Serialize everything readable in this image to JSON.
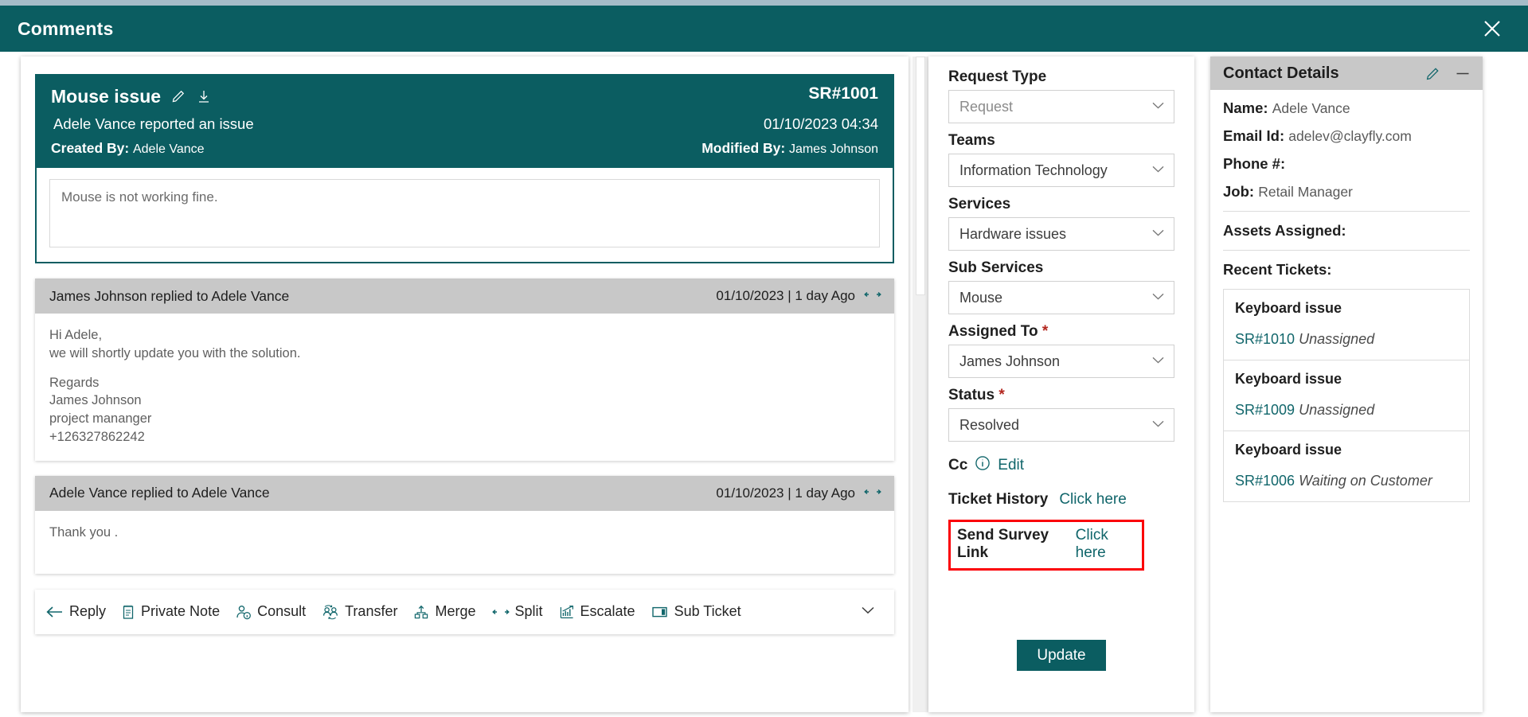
{
  "theme": {
    "teal": "#0b5d61",
    "link_teal": "#11666b",
    "grey_head": "#c8c8c8",
    "red_highlight": "#fb0007"
  },
  "window": {
    "title": "Comments",
    "close_icon": "close-icon"
  },
  "ticket": {
    "subject": "Mouse issue",
    "edit_icon": "pencil-icon",
    "download_icon": "download-icon",
    "id": "SR#1001",
    "reported_line": "Adele Vance reported an issue",
    "created_at": "01/10/2023 04:34",
    "created_by_label": "Created By:",
    "created_by": "Adele Vance",
    "modified_by_label": "Modified By:",
    "modified_by": "James Johnson",
    "description": "Mouse is not working fine."
  },
  "replies": [
    {
      "header": "James Johnson replied to Adele Vance",
      "timestamp": "01/10/2023 | 1 day Ago",
      "expand_icon": "expand-horizontal-icon",
      "lines": [
        "Hi Adele,",
        "we will shortly update you with the solution.",
        "",
        "Regards",
        "James Johnson",
        "project mananger",
        "+126327862242"
      ]
    },
    {
      "header": "Adele Vance replied to Adele Vance",
      "timestamp": "01/10/2023 | 1 day Ago",
      "expand_icon": "expand-horizontal-icon",
      "lines": [
        "Thank you ."
      ]
    }
  ],
  "toolbar": {
    "items": [
      {
        "label": "Reply",
        "icon": "reply-arrow-icon"
      },
      {
        "label": "Private Note",
        "icon": "note-icon"
      },
      {
        "label": "Consult",
        "icon": "person-info-icon"
      },
      {
        "label": "Transfer",
        "icon": "transfer-people-icon"
      },
      {
        "label": "Merge",
        "icon": "merge-icon"
      },
      {
        "label": "Split",
        "icon": "split-arrows-icon"
      },
      {
        "label": "Escalate",
        "icon": "escalate-chart-icon"
      },
      {
        "label": "Sub Ticket",
        "icon": "sub-ticket-columns-icon"
      }
    ],
    "more_icon": "chevron-down-icon"
  },
  "form": {
    "fields": [
      {
        "label": "Request Type",
        "value": "Request",
        "required": false,
        "placeholder_style": true,
        "caret": "chevron-down-icon"
      },
      {
        "label": "Teams",
        "value": "Information Technology",
        "required": false,
        "placeholder_style": false,
        "caret": "chevron-down-icon"
      },
      {
        "label": "Services",
        "value": "Hardware issues",
        "required": false,
        "placeholder_style": false,
        "caret": "chevron-down-icon"
      },
      {
        "label": "Sub Services",
        "value": "Mouse",
        "required": false,
        "placeholder_style": false,
        "caret": "chevron-down-icon"
      },
      {
        "label": "Assigned To",
        "value": "James Johnson",
        "required": true,
        "placeholder_style": false,
        "caret": "chevron-down-icon"
      },
      {
        "label": "Status",
        "value": "Resolved",
        "required": true,
        "placeholder_style": false,
        "caret": "chevron-down-icon"
      }
    ],
    "cc": {
      "label": "Cc",
      "info_icon": "info-circle-icon",
      "link": "Edit"
    },
    "ticket_history": {
      "label": "Ticket History",
      "link": "Click here"
    },
    "send_survey": {
      "label": "Send Survey Link",
      "link": "Click here",
      "highlighted": true
    },
    "update_label": "Update"
  },
  "contact": {
    "panel_title": "Contact Details",
    "edit_icon": "pencil-icon",
    "minimize_icon": "minimize-icon",
    "name_label": "Name:",
    "name": "Adele Vance",
    "email_label": "Email Id:",
    "email": "adelev@clayfly.com",
    "phone_label": "Phone #:",
    "phone": "",
    "job_label": "Job:",
    "job": "Retail Manager",
    "assets_label": "Assets Assigned:",
    "recent_label": "Recent Tickets:",
    "recent_tickets": [
      {
        "title": "Keyboard issue",
        "id": "SR#1010",
        "status": "Unassigned"
      },
      {
        "title": "Keyboard issue",
        "id": "SR#1009",
        "status": "Unassigned"
      },
      {
        "title": "Keyboard issue",
        "id": "SR#1006",
        "status": "Waiting on Customer"
      }
    ]
  }
}
